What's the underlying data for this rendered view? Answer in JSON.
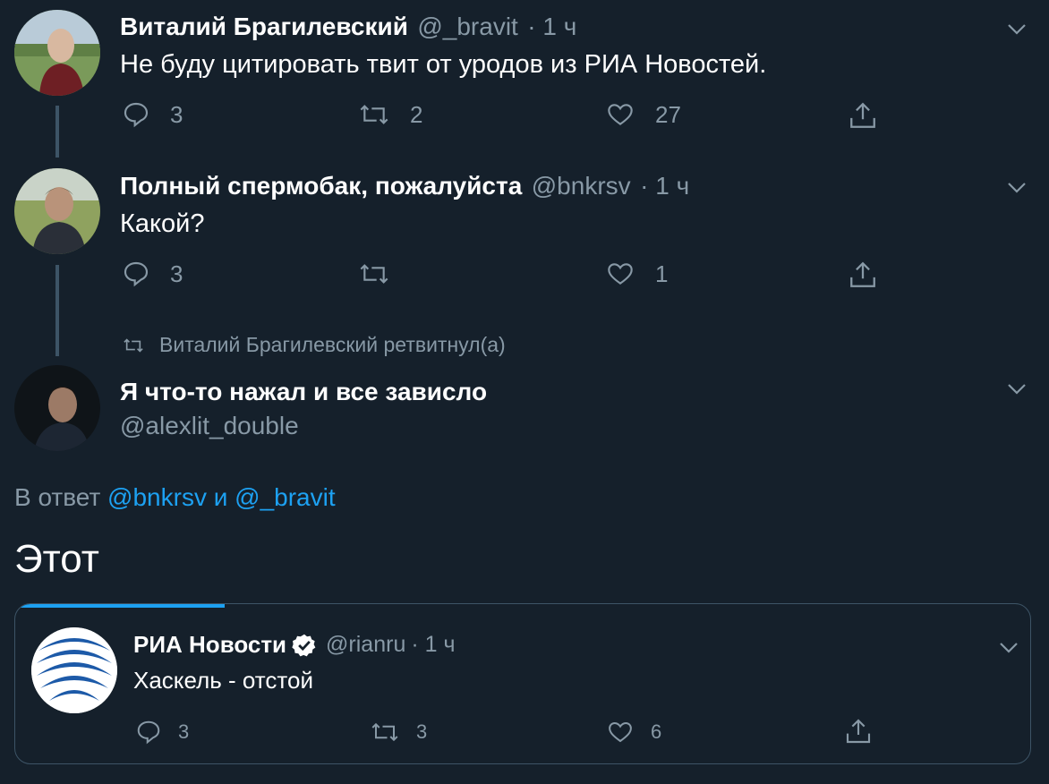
{
  "tweets": [
    {
      "name": "Виталий Брагилевский",
      "handle": "@_bravit",
      "time": "· 1 ч",
      "text": "Не буду цитировать твит от уродов из РИА Новостей.",
      "replies": "3",
      "retweets": "2",
      "likes": "27"
    },
    {
      "name": "Полный спермобак, пожалуйста",
      "handle": "@bnkrsv",
      "time": "· 1 ч",
      "text": "Какой?",
      "replies": "3",
      "retweets": "",
      "likes": "1"
    }
  ],
  "retweet_context": "Виталий Брагилевский ретвитнул(а)",
  "main_tweet": {
    "name": "Я что-то нажал и все зависло",
    "handle": "@alexlit_double",
    "reply_prefix": "В ответ",
    "reply_user1": "@bnkrsv",
    "reply_and": "и",
    "reply_user2": "@_bravit",
    "text": "Этот"
  },
  "quoted_tweet": {
    "name": "РИА Новости",
    "handle": "@rianru",
    "time": "· 1 ч",
    "text": "Хаскель - отстой",
    "replies": "3",
    "retweets": "3",
    "likes": "6"
  },
  "icons": [
    "chevron-down-icon",
    "reply-icon",
    "retweet-icon",
    "like-icon",
    "share-icon",
    "verified-icon"
  ],
  "colors": {
    "background": "#15202b",
    "muted": "#8899a6",
    "link": "#1da1f2",
    "progress": "#1da1f2"
  }
}
